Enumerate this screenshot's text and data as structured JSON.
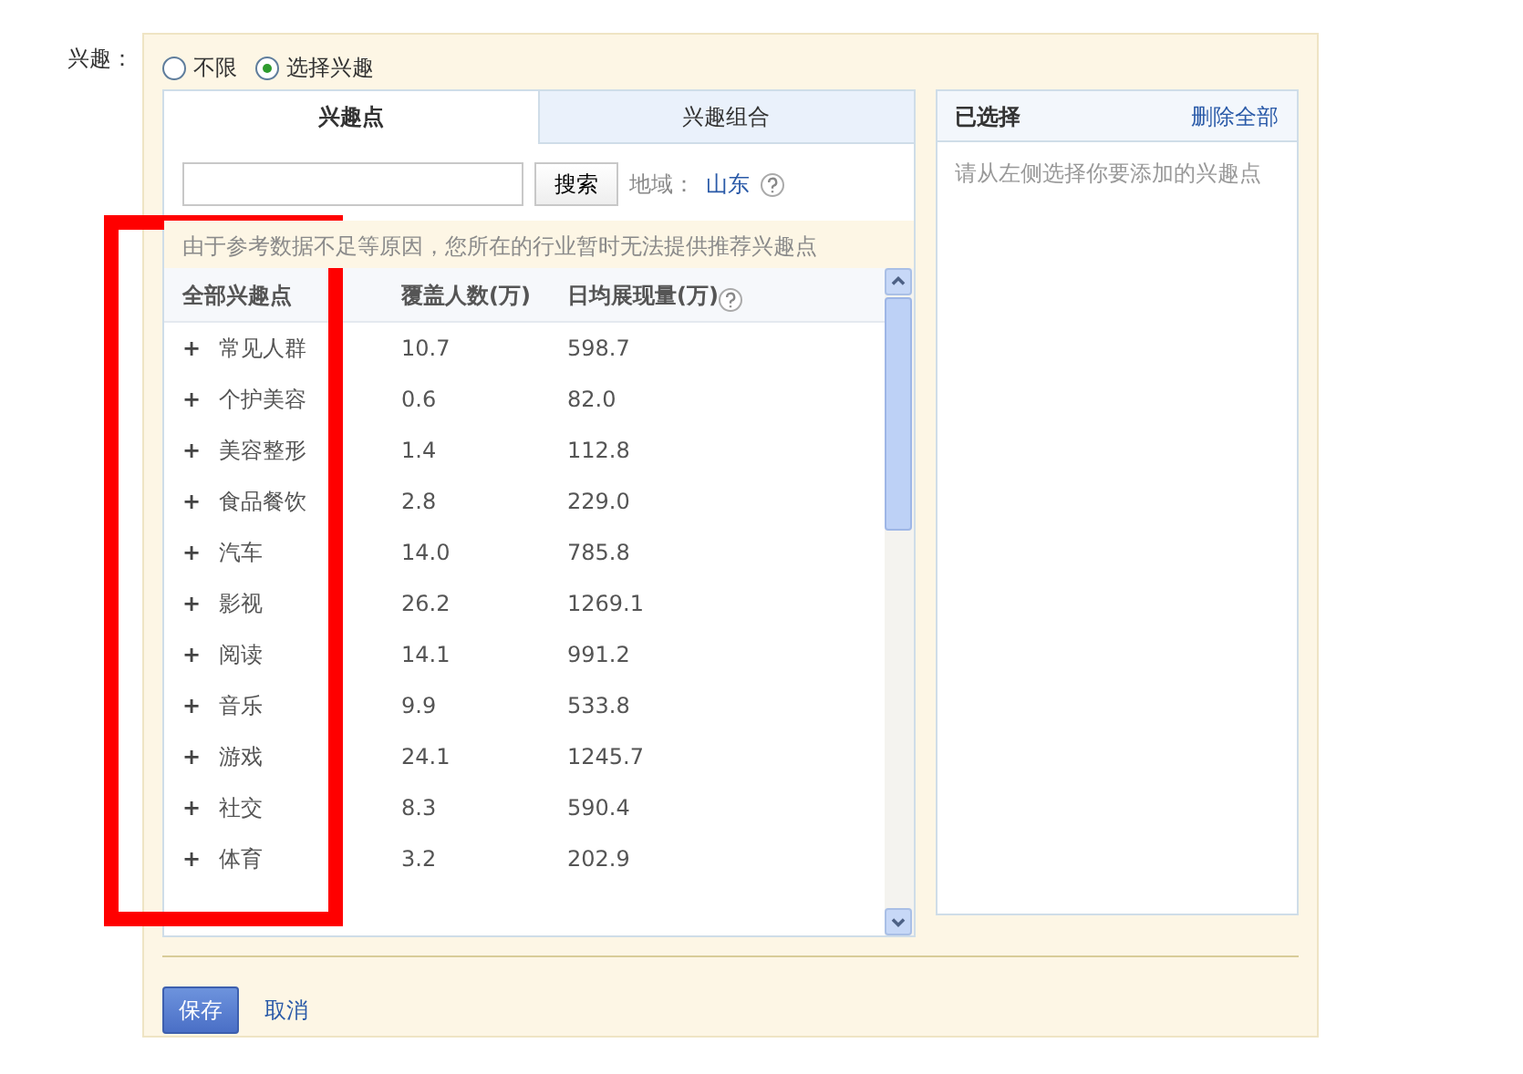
{
  "field_label": "兴趣：",
  "scope_options": [
    {
      "label": "不限",
      "selected": false
    },
    {
      "label": "选择兴趣",
      "selected": true
    }
  ],
  "tabs": [
    {
      "label": "兴趣点",
      "selected": true
    },
    {
      "label": "兴趣组合",
      "selected": false
    }
  ],
  "search": {
    "button": "搜索",
    "region_label": "地域：",
    "region_value": "山东"
  },
  "notice": "由于参考数据不足等原因，您所在的行业暂时无法提供推荐兴趣点",
  "table": {
    "columns": [
      "全部兴趣点",
      "覆盖人数(万)",
      "日均展现量(万)"
    ],
    "rows": [
      {
        "expander": "+",
        "name": "常见人群",
        "coverage": "10.7",
        "impressions": "598.7"
      },
      {
        "expander": "+",
        "name": "个护美容",
        "coverage": "0.6",
        "impressions": "82.0"
      },
      {
        "expander": "+",
        "name": "美容整形",
        "coverage": "1.4",
        "impressions": "112.8"
      },
      {
        "expander": "+",
        "name": "食品餐饮",
        "coverage": "2.8",
        "impressions": "229.0"
      },
      {
        "expander": "+",
        "name": "汽车",
        "coverage": "14.0",
        "impressions": "785.8"
      },
      {
        "expander": "+",
        "name": "影视",
        "coverage": "26.2",
        "impressions": "1269.1"
      },
      {
        "expander": "+",
        "name": "阅读",
        "coverage": "14.1",
        "impressions": "991.2"
      },
      {
        "expander": "+",
        "name": "音乐",
        "coverage": "9.9",
        "impressions": "533.8"
      },
      {
        "expander": "+",
        "name": "游戏",
        "coverage": "24.1",
        "impressions": "1245.7"
      },
      {
        "expander": "+",
        "name": "社交",
        "coverage": "8.3",
        "impressions": "590.4"
      },
      {
        "expander": "+",
        "name": "体育",
        "coverage": "3.2",
        "impressions": "202.9"
      }
    ]
  },
  "selected_panel": {
    "title": "已选择",
    "clear_link": "删除全部",
    "empty_hint": "请从左侧选择你要添加的兴趣点"
  },
  "actions": {
    "save": "保存",
    "cancel": "取消"
  }
}
